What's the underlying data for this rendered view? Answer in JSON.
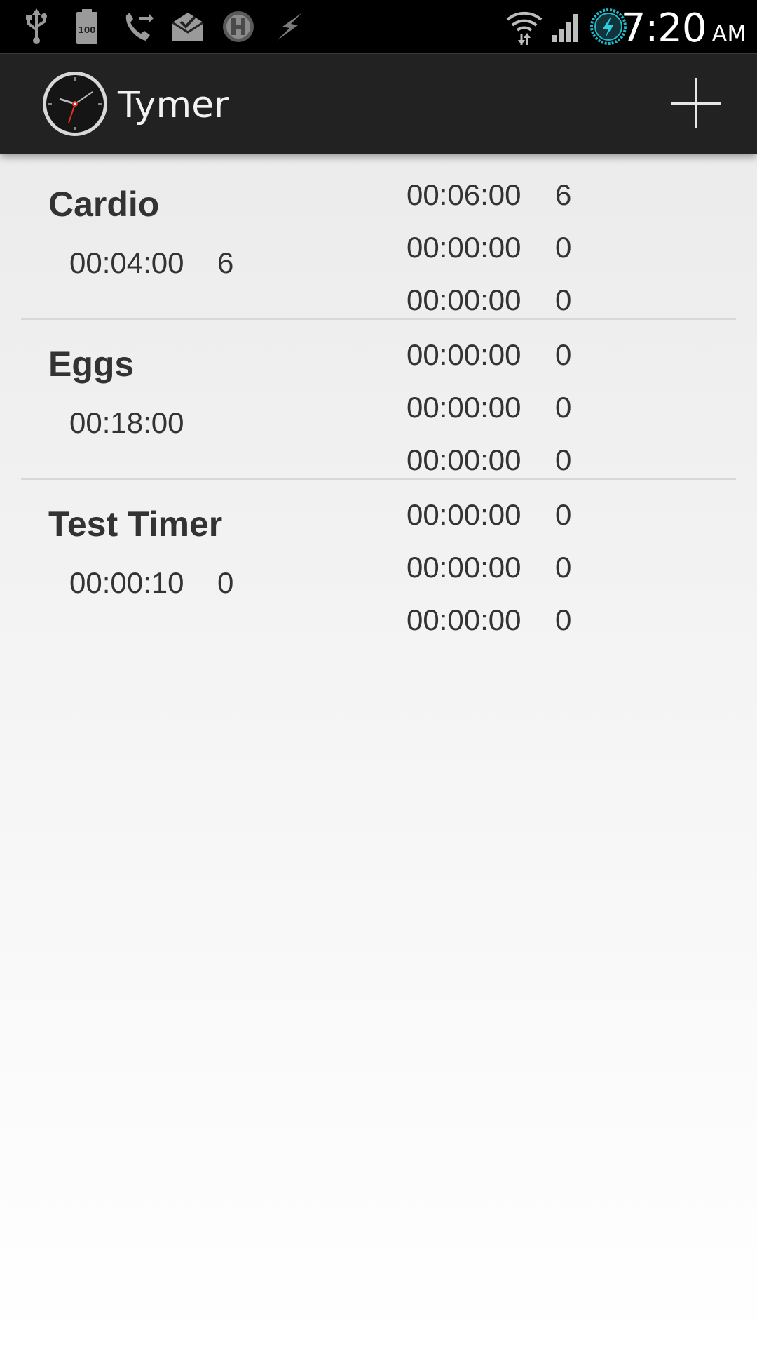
{
  "status_bar": {
    "time": "7:20",
    "ampm": "AM",
    "battery_label": "100",
    "icons": [
      "usb-icon",
      "battery-icon",
      "call-forward-icon",
      "mail-icon",
      "hangouts-icon",
      "flash-icon",
      "wifi-icon",
      "signal-icon",
      "charging-icon"
    ]
  },
  "app_bar": {
    "title": "Tymer",
    "add_icon": "plus-icon"
  },
  "timers": [
    {
      "name": "Cardio",
      "main_time": "00:04:00",
      "main_count": "6",
      "subs": [
        {
          "time": "00:06:00",
          "count": "6"
        },
        {
          "time": "00:00:00",
          "count": "0"
        },
        {
          "time": "00:00:00",
          "count": "0"
        }
      ]
    },
    {
      "name": "Eggs",
      "main_time": "00:18:00",
      "main_count": "",
      "subs": [
        {
          "time": "00:00:00",
          "count": "0"
        },
        {
          "time": "00:00:00",
          "count": "0"
        },
        {
          "time": "00:00:00",
          "count": "0"
        }
      ]
    },
    {
      "name": "Test Timer",
      "main_time": "00:00:10",
      "main_count": "0",
      "subs": [
        {
          "time": "00:00:00",
          "count": "0"
        },
        {
          "time": "00:00:00",
          "count": "0"
        },
        {
          "time": "00:00:00",
          "count": "0"
        }
      ]
    }
  ]
}
